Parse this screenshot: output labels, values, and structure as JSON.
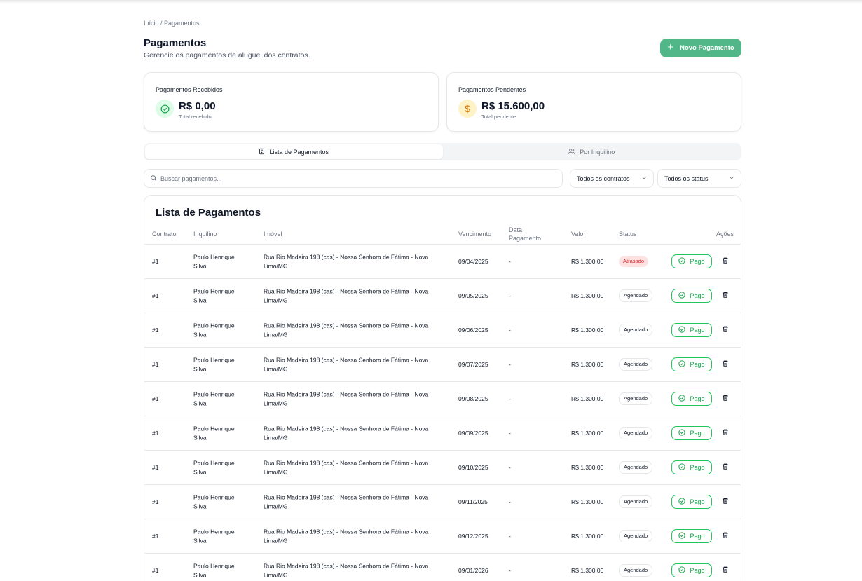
{
  "breadcrumb": "Início / Pagamentos",
  "header": {
    "title": "Pagamentos",
    "subtitle": "Gerencie os pagamentos de aluguel dos contratos.",
    "new_button": "Novo Pagamento"
  },
  "cards": {
    "received": {
      "title": "Pagamentos Recebidos",
      "value": "R$ 0,00",
      "caption": "Total recebido",
      "icon": "check-circle-icon"
    },
    "pending": {
      "title": "Pagamentos Pendentes",
      "value": "R$ 15.600,00",
      "caption": "Total pendente",
      "icon": "dollar-icon"
    }
  },
  "tabs": [
    {
      "label": "Lista de Pagamentos",
      "active": true,
      "icon": "receipt-icon"
    },
    {
      "label": "Por Inquilino",
      "active": false,
      "icon": "users-icon"
    }
  ],
  "search": {
    "placeholder": "Buscar pagamentos..."
  },
  "filters": {
    "contracts": "Todos os contratos",
    "status": "Todos os status"
  },
  "table": {
    "title": "Lista de Pagamentos",
    "columns": {
      "contract": "Contrato",
      "tenant": "Inquilino",
      "property": "Imóvel",
      "due": "Vencimento",
      "paid_date_1": "Data",
      "paid_date_2": "Pagamento",
      "value": "Valor",
      "status": "Status",
      "actions": "Ações"
    },
    "action_label": "Pago",
    "rows": [
      {
        "contract": "#1",
        "tenant_1": "Paulo Henrique",
        "tenant_2": "Silva",
        "property_1": "Rua Rio Madeira 198 (cas) - Nossa Senhora de Fátima - Nova",
        "property_2": "Lima/MG",
        "due": "09/04/2025",
        "paid": "-",
        "value": "R$ 1.300,00",
        "status": "Atrasado"
      },
      {
        "contract": "#1",
        "tenant_1": "Paulo Henrique",
        "tenant_2": "Silva",
        "property_1": "Rua Rio Madeira 198 (cas) - Nossa Senhora de Fátima - Nova",
        "property_2": "Lima/MG",
        "due": "09/05/2025",
        "paid": "-",
        "value": "R$ 1.300,00",
        "status": "Agendado"
      },
      {
        "contract": "#1",
        "tenant_1": "Paulo Henrique",
        "tenant_2": "Silva",
        "property_1": "Rua Rio Madeira 198 (cas) - Nossa Senhora de Fátima - Nova",
        "property_2": "Lima/MG",
        "due": "09/06/2025",
        "paid": "-",
        "value": "R$ 1.300,00",
        "status": "Agendado"
      },
      {
        "contract": "#1",
        "tenant_1": "Paulo Henrique",
        "tenant_2": "Silva",
        "property_1": "Rua Rio Madeira 198 (cas) - Nossa Senhora de Fátima - Nova",
        "property_2": "Lima/MG",
        "due": "09/07/2025",
        "paid": "-",
        "value": "R$ 1.300,00",
        "status": "Agendado"
      },
      {
        "contract": "#1",
        "tenant_1": "Paulo Henrique",
        "tenant_2": "Silva",
        "property_1": "Rua Rio Madeira 198 (cas) - Nossa Senhora de Fátima - Nova",
        "property_2": "Lima/MG",
        "due": "09/08/2025",
        "paid": "-",
        "value": "R$ 1.300,00",
        "status": "Agendado"
      },
      {
        "contract": "#1",
        "tenant_1": "Paulo Henrique",
        "tenant_2": "Silva",
        "property_1": "Rua Rio Madeira 198 (cas) - Nossa Senhora de Fátima - Nova",
        "property_2": "Lima/MG",
        "due": "09/09/2025",
        "paid": "-",
        "value": "R$ 1.300,00",
        "status": "Agendado"
      },
      {
        "contract": "#1",
        "tenant_1": "Paulo Henrique",
        "tenant_2": "Silva",
        "property_1": "Rua Rio Madeira 198 (cas) - Nossa Senhora de Fátima - Nova",
        "property_2": "Lima/MG",
        "due": "09/10/2025",
        "paid": "-",
        "value": "R$ 1.300,00",
        "status": "Agendado"
      },
      {
        "contract": "#1",
        "tenant_1": "Paulo Henrique",
        "tenant_2": "Silva",
        "property_1": "Rua Rio Madeira 198 (cas) - Nossa Senhora de Fátima - Nova",
        "property_2": "Lima/MG",
        "due": "09/11/2025",
        "paid": "-",
        "value": "R$ 1.300,00",
        "status": "Agendado"
      },
      {
        "contract": "#1",
        "tenant_1": "Paulo Henrique",
        "tenant_2": "Silva",
        "property_1": "Rua Rio Madeira 198 (cas) - Nossa Senhora de Fátima - Nova",
        "property_2": "Lima/MG",
        "due": "09/12/2025",
        "paid": "-",
        "value": "R$ 1.300,00",
        "status": "Agendado"
      },
      {
        "contract": "#1",
        "tenant_1": "Paulo Henrique",
        "tenant_2": "Silva",
        "property_1": "Rua Rio Madeira 198 (cas) - Nossa Senhora de Fátima - Nova",
        "property_2": "Lima/MG",
        "due": "09/01/2026",
        "paid": "-",
        "value": "R$ 1.300,00",
        "status": "Agendado"
      }
    ]
  },
  "colors": {
    "primary": "#52b788",
    "late_bg": "#fee2e2",
    "late_text": "#dc2626",
    "paid_border": "#22c55e"
  }
}
